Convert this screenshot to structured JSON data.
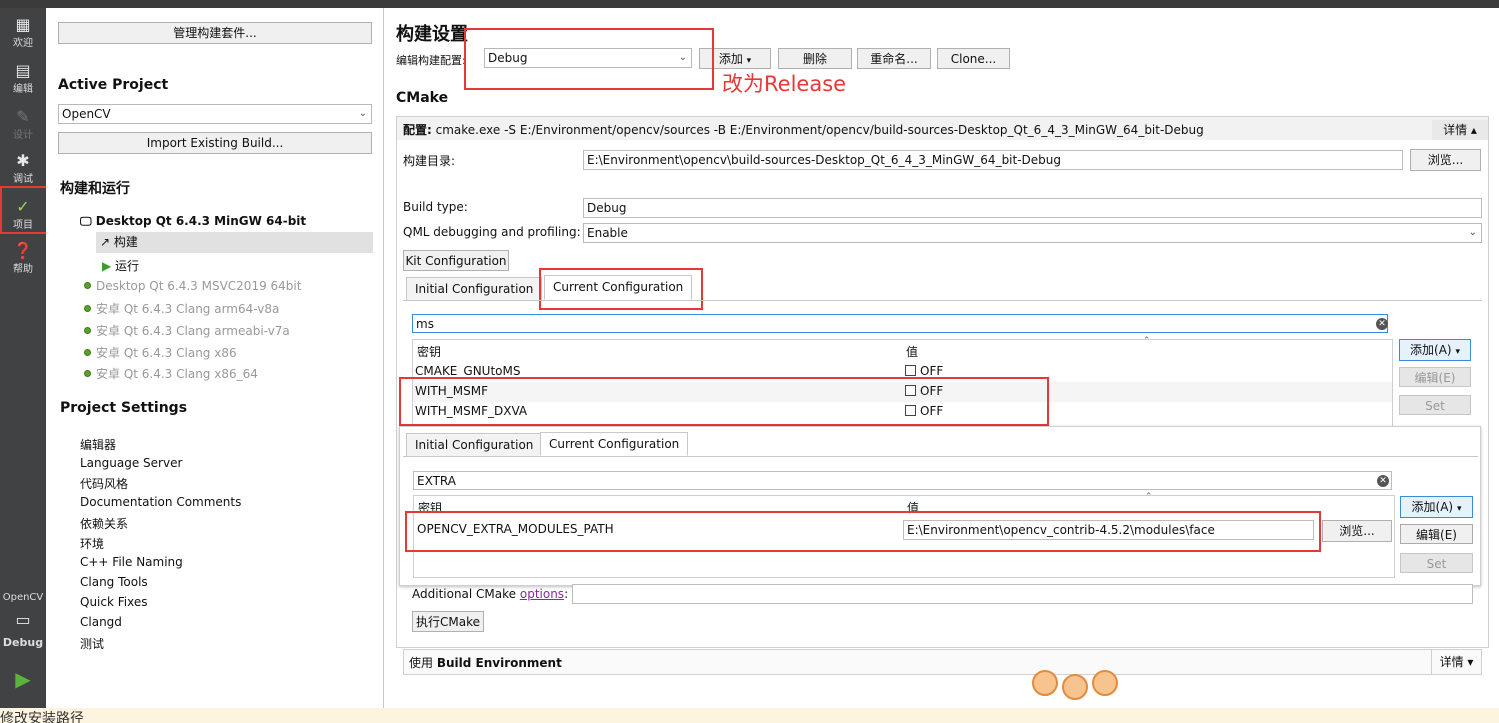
{
  "modebar": {
    "items": [
      {
        "label": "欢迎",
        "icon": "grid-icon"
      },
      {
        "label": "编辑",
        "icon": "edit-icon"
      },
      {
        "label": "设计",
        "icon": "pencil-icon"
      },
      {
        "label": "调试",
        "icon": "bug-icon"
      },
      {
        "label": "项目",
        "icon": "wrench-icon"
      },
      {
        "label": "帮助",
        "icon": "help-icon"
      }
    ],
    "project": "OpenCV",
    "build": "Debug"
  },
  "left": {
    "manage_kits": "管理构建套件...",
    "active_project": "Active Project",
    "project_value": "OpenCV",
    "import_build": "Import Existing Build...",
    "build_run": "构建和运行",
    "kit_main": "Desktop Qt 6.4.3 MinGW 64-bit",
    "build": "构建",
    "run": "运行",
    "kits": [
      "Desktop Qt 6.4.3 MSVC2019 64bit",
      "安卓 Qt 6.4.3 Clang arm64-v8a",
      "安卓 Qt 6.4.3 Clang armeabi-v7a",
      "安卓 Qt 6.4.3 Clang x86",
      "安卓 Qt 6.4.3 Clang x86_64"
    ],
    "project_settings": "Project Settings",
    "settings": [
      "编辑器",
      "Language Server",
      "代码风格",
      "Documentation Comments",
      "依赖关系",
      "环境",
      "C++ File Naming",
      "Clang Tools",
      "Quick Fixes",
      "Clangd",
      "测试"
    ]
  },
  "main": {
    "title": "构建设置",
    "edit_config_label": "编辑构建配置:",
    "config_value": "Debug",
    "add": "添加",
    "delete": "删除",
    "rename": "重命名...",
    "clone": "Clone...",
    "annotation": "改为Release",
    "cmake": "CMake",
    "config_prefix": "配置:",
    "config_cmd": "cmake.exe -S E:/Environment/opencv/sources -B E:/Environment/opencv/build-sources-Desktop_Qt_6_4_3_MinGW_64_bit-Debug",
    "details": "详情",
    "build_dir_label": "构建目录:",
    "build_dir": "E:\\Environment\\opencv\\build-sources-Desktop_Qt_6_4_3_MinGW_64_bit-Debug",
    "browse": "浏览...",
    "build_type_label": "Build type:",
    "build_type": "Debug",
    "qml_label": "QML debugging and profiling:",
    "qml_value": "Enable",
    "kit_config": "Kit Configuration",
    "tab_initial": "Initial Configuration",
    "tab_current": "Current Configuration",
    "filter1": "ms",
    "col_key": "密钥",
    "col_value": "值",
    "rows1": [
      {
        "key": "CMAKE_GNUtoMS",
        "value": "OFF"
      },
      {
        "key": "WITH_MSMF",
        "value": "OFF"
      },
      {
        "key": "WITH_MSMF_DXVA",
        "value": "OFF"
      }
    ],
    "side_add": "添加(A)",
    "side_edit": "编辑(E)",
    "side_set": "Set",
    "filter2": "EXTRA",
    "row2_key": "OPENCV_EXTRA_MODULES_PATH",
    "row2_value": "E:\\Environment\\opencv_contrib-4.5.2\\modules\\face",
    "row2_browse": "浏览...",
    "additional_label": "Additional CMake ",
    "options_link": "options",
    "colon": ":",
    "run_cmake": "执行CMake",
    "use_env_prefix": "使用 ",
    "use_env_bold": "Build Environment",
    "details2": "详情",
    "caption": "修改安装路径"
  }
}
